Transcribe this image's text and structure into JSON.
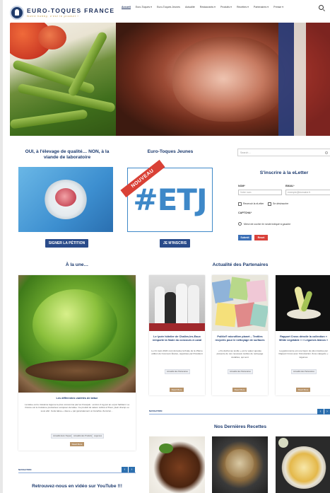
{
  "header": {
    "brand_name": "EURO-TOQUES FRANCE",
    "brand_tagline": "Notre hobby, c'est le produit !",
    "nav": [
      "Accueil",
      "Euro-Toques ▾",
      "Euro-Toques Jeunes",
      "Actualité",
      "Restaurants ▾",
      "Produits ▾",
      "Recettes ▾",
      "Partenaires ▾",
      "Presse ▾"
    ]
  },
  "colors": {
    "navy": "#1c3a6e",
    "button_blue": "#2a4b8a",
    "submit_blue": "#3b6fb6",
    "reset_red": "#d9413a",
    "more_tan": "#b8946a"
  },
  "petition": {
    "title": "OUI, à l'élevage de qualité… NON, à la viande de laboratoire",
    "button": "SIGNER LA PÉTITION"
  },
  "etj": {
    "title": "Euro-Toques Jeunes",
    "badge": "NOUVEAU",
    "logo_text": "#ETJ",
    "button": "JE M'INSCRIS"
  },
  "sidebar": {
    "search_placeholder": "Search ...",
    "newsletter_title": "S'inscrire à la eLetter",
    "nom_label": "NOM*",
    "nom_placeholder": "Votre nom",
    "email_label": "EMAIL*",
    "email_placeholder": "exemple@domaine.fr",
    "checkbox1": "Recevoir la eLetter",
    "checkbox2": "Se désinscrire",
    "captcha_label": "CAPTCHA*",
    "captcha_text": "Merci de cocher le ronde indiqué à gauche",
    "submit": "Submit",
    "reset": "Reset"
  },
  "a_la_une": {
    "title": "À la une…",
    "card_title": "Les différentes variétés de laitue",
    "card_text": "La laitue est le troisième légume le plus consommé par les Français : environ 4 kg par an et par habitant. La France est le troisième producteur européen de laitue. Ce produit de saison cultivé à l'hiver, plein champ ou sous abri. Cette laitue « douce » par généralement un bénéfice d'environ…",
    "tags": [
      "Actualité Euro-Toques",
      "Actualité des Produits",
      "Légumes"
    ],
    "more": "Read More",
    "nav_label": "NAVIGATION"
  },
  "partenaires": {
    "title": "Actualité des Partenaires",
    "cards": [
      {
        "title": "Le lycée hôtelier de Challes-les-Eaux remporte la finale du concours à Laval",
        "text": "Le 21 mars 2024 s'est déroulée la finale de la 15ème édition du Concours Écoles, organisée par Président",
        "tag": "Actualité des Partenaires",
        "more": "Read More"
      },
      {
        "title": "Politix® microfibre planet – Textiles recyclés pour le nettoyage de surfaces",
        "text": "« Du déchet au textile » est le valeur ajoutée présente de nos nouveaux textiles de nettoyage durables, qui sont",
        "tag": "Actualité des Partenaires",
        "more": "Read More"
      },
      {
        "title": "Rapport Cross dévoile la collection « White vegetable » « Légumes blancs »",
        "text": "La gastronomie est une façon de plus inspirée par Rapport Cross avec l'introduction d'une catégorie « légumes",
        "tag": "Actualité des Partenaires",
        "more": "Read More"
      }
    ],
    "nav_label": "NAVIGATION"
  },
  "recettes": {
    "title": "Nos Dernières Recettes"
  },
  "youtube": {
    "title": "Retrouvez-nous en vidéo sur YouTube !!!"
  }
}
